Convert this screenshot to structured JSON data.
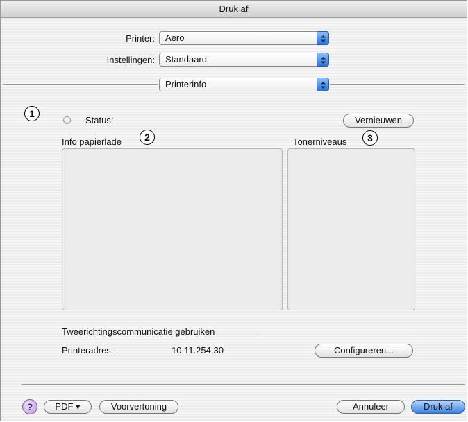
{
  "window": {
    "title": "Druk af"
  },
  "printer": {
    "label": "Printer:",
    "value": "Aero"
  },
  "settings": {
    "label": "Instellingen:",
    "value": "Standaard"
  },
  "panel": {
    "value": "Printerinfo"
  },
  "markers": {
    "one": "1",
    "two": "2",
    "three": "3"
  },
  "status": {
    "label": "Status:"
  },
  "refresh_label": "Vernieuwen",
  "tray": {
    "label": "Info papierlade"
  },
  "toner": {
    "label": "Tonerniveaus"
  },
  "bidirectional": {
    "label": "Tweerichtingscommunicatie gebruiken"
  },
  "address": {
    "label": "Printeradres:",
    "value": "10.11.254.30"
  },
  "configure_label": "Configureren...",
  "footer": {
    "help": "?",
    "pdf": "PDF ▾",
    "preview": "Voorvertoning",
    "cancel": "Annuleer",
    "print": "Druk af"
  },
  "colors": {
    "accent": "#3b84e4",
    "help": "#b58fd6"
  }
}
